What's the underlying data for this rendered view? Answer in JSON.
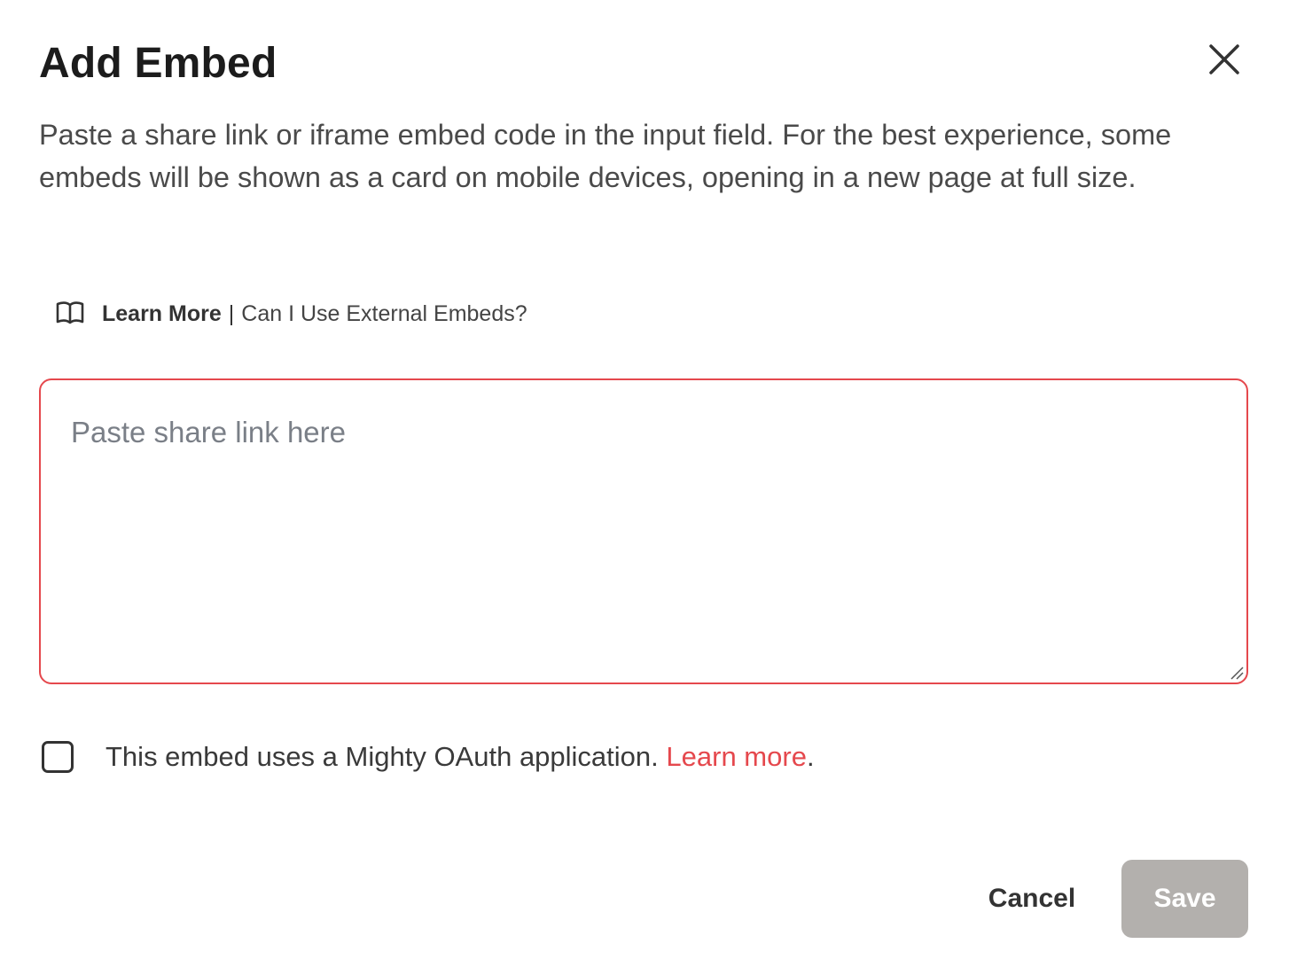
{
  "modal": {
    "title": "Add Embed",
    "close_icon": "close-icon",
    "description": "Paste a share link or iframe embed code in the input field. For the best experience, some embeds will be shown as a card on mobile devices, opening in a new page at full size."
  },
  "learn_more": {
    "icon": "book-icon",
    "bold_label": "Learn More",
    "separator": "|",
    "link_text": "Can I Use External Embeds?"
  },
  "embed_input": {
    "value": "",
    "placeholder": "Paste share link here",
    "border_color": "#e5484d"
  },
  "oauth_option": {
    "checked": false,
    "label": "This embed uses a Mighty OAuth application.",
    "link_text": "Learn more",
    "trailing": ".",
    "link_color": "#e5484d"
  },
  "footer": {
    "cancel_label": "Cancel",
    "save_label": "Save",
    "save_disabled": true,
    "save_bg_color": "#b3b0ad"
  }
}
